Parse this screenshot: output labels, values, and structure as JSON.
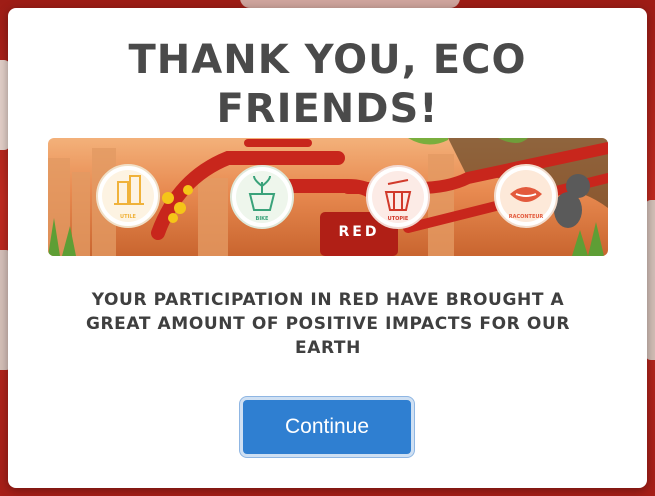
{
  "modal": {
    "title_line1": "THANK YOU, ECO",
    "title_line2": "FRIENDS!",
    "message_line1": "YOUR PARTICIPATION IN RED HAVE BROUGHT A",
    "message_line2": "GREAT AMOUNT OF POSITIVE IMPACTS FOR OUR",
    "message_line3": "EARTH",
    "continue_label": "Continue"
  },
  "banner": {
    "sign_text": "RED",
    "badges": [
      {
        "label": "UTILE",
        "icon": "building-icon"
      },
      {
        "label": "BIKE",
        "icon": "plant-pot-icon"
      },
      {
        "label": "UTOPIE",
        "icon": "basket-icon"
      },
      {
        "label": "RACONTEUR",
        "icon": "mouth-icon"
      }
    ]
  },
  "colors": {
    "primary_button": "#2f7fd1",
    "title_text": "#4a4a4a",
    "backdrop": "#b8241c",
    "banner_red": "#c8261c"
  }
}
